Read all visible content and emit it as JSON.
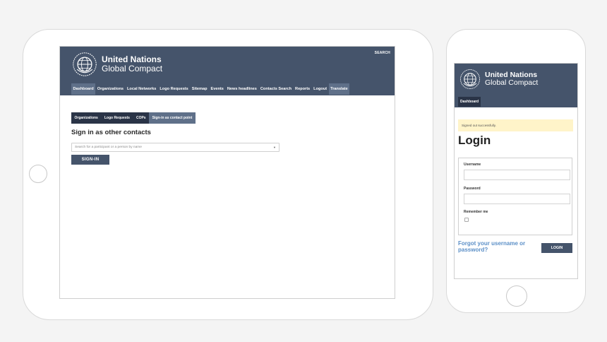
{
  "brand": {
    "title": "United Nations",
    "subtitle": "Global Compact",
    "logo_icon": "un-global-compact-emblem-icon"
  },
  "colors": {
    "header": "#45546b",
    "subnav": "#2a3447",
    "active_tab": "#5f7089",
    "link": "#5b8fc7",
    "alert": "#fff4c9"
  },
  "tablet": {
    "search_label": "SEARCH",
    "main_nav": [
      {
        "label": "Dashboard",
        "active": true
      },
      {
        "label": "Organizations"
      },
      {
        "label": "Local Networks"
      },
      {
        "label": "Logo Requests"
      },
      {
        "label": "Sitemap"
      },
      {
        "label": "Events"
      },
      {
        "label": "News headlines"
      },
      {
        "label": "Contacts Search"
      },
      {
        "label": "Reports"
      },
      {
        "label": "Logout"
      },
      {
        "label": "Translate"
      }
    ],
    "sub_nav": [
      {
        "label": "Organizations"
      },
      {
        "label": "Logo Requests"
      },
      {
        "label": "COPs"
      },
      {
        "label": "Sign-in as contact point",
        "active": true
      }
    ],
    "page_title": "Sign in as other contacts",
    "search_placeholder": "Search for a participant or a person by name",
    "signin_button": "SIGN-IN"
  },
  "phone": {
    "nav_item": "Dashboard",
    "alert_message": "Signed out successfully.",
    "login_title": "Login",
    "username_label": "Username",
    "password_label": "Password",
    "remember_label": "Remember me",
    "forgot_link": "Forgot your username or password?",
    "login_button": "LOGIN"
  }
}
